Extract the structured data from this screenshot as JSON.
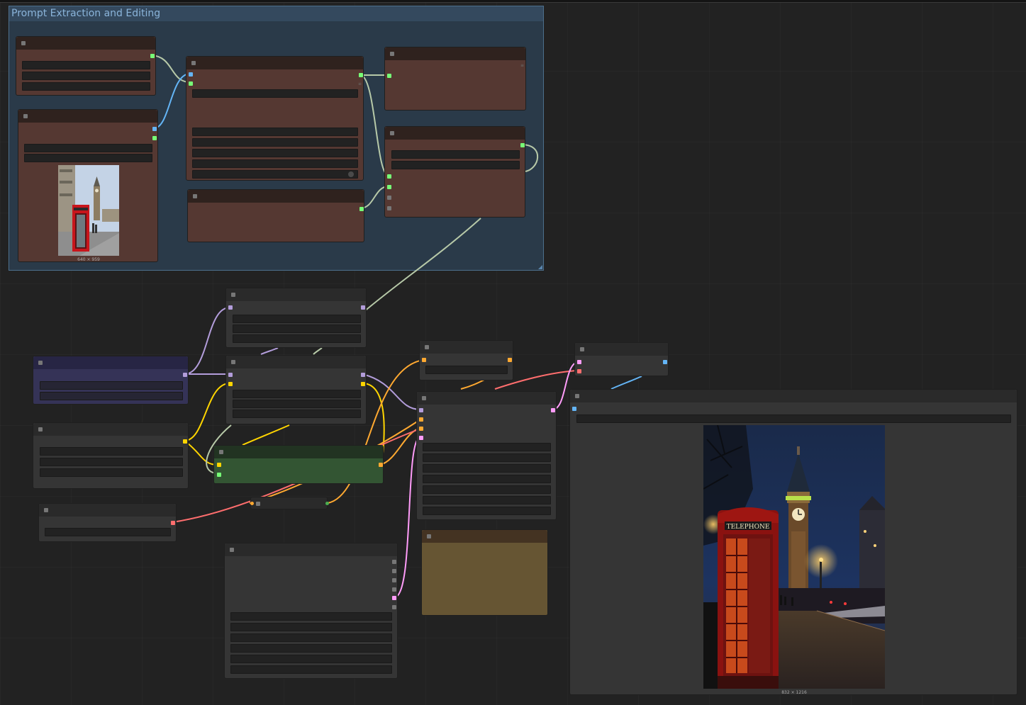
{
  "group": {
    "title": "Prompt Extraction and Editing"
  },
  "images": {
    "input_caption": "640 × 959",
    "output_caption": "832 × 1216",
    "output_sign": "TELEPHONE"
  },
  "link_colors": {
    "model": "#b39ddb",
    "clip": "#ffd500",
    "vae": "#ff6e6e",
    "conditioning": "#ffa931",
    "latent": "#ff9cf9",
    "image": "#64b5f6",
    "string": "#77ff77",
    "string_wire": "#b7c9a8"
  }
}
